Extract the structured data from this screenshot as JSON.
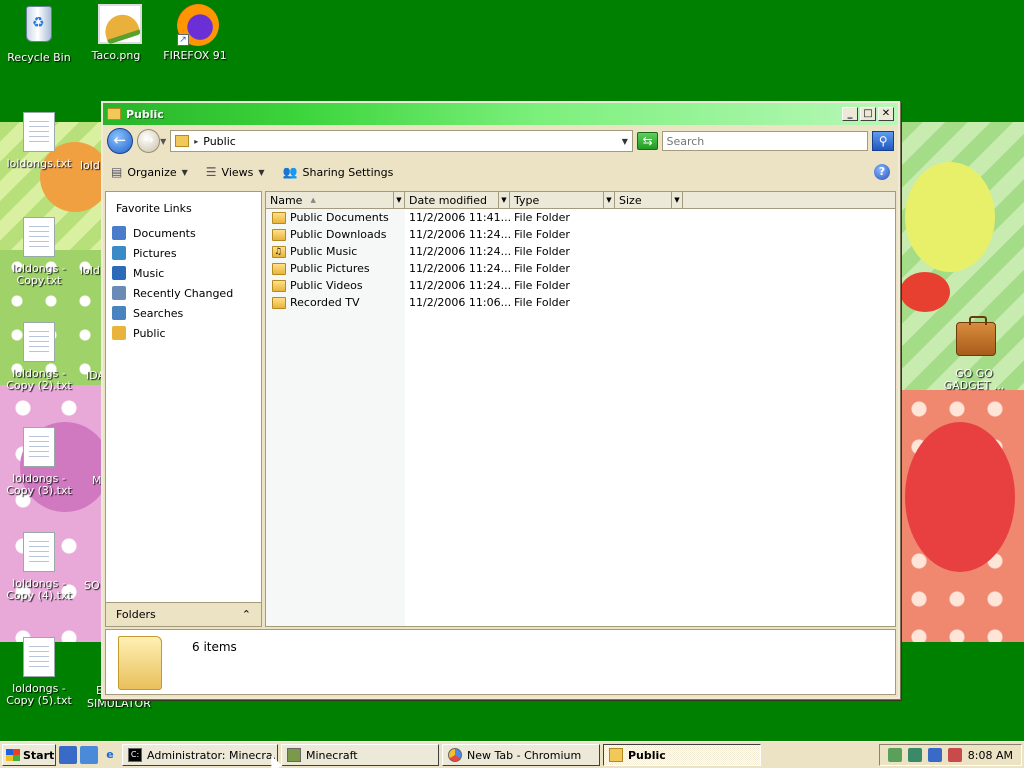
{
  "desktop": {
    "top_icons": [
      {
        "label": "Recycle Bin",
        "icon": "recycle-bin-icon"
      },
      {
        "label": "Taco.png",
        "icon": "image-file-icon"
      },
      {
        "label": "FIREFOX 91",
        "icon": "firefox-icon"
      }
    ],
    "left_icons": [
      {
        "label": "loldongs.txt"
      },
      {
        "label": "loldongs - Copy.txt"
      },
      {
        "label": "loldongs - Copy (2).txt"
      },
      {
        "label": "loldongs - Copy (3).txt"
      },
      {
        "label": "loldongs - Copy (4).txt"
      },
      {
        "label": "loldongs - Copy (5).txt"
      }
    ],
    "partial_labels": {
      "p1": "lold",
      "p2": "lold",
      "p3": "IDA",
      "p4": "M",
      "p5": "SO",
      "p6": "E",
      "p7": "SIMULATOR"
    },
    "right_icon": {
      "label": "GO GO GADGET ...",
      "icon": "briefcase-icon"
    }
  },
  "window": {
    "title": "Public",
    "controls": {
      "minimize": "_",
      "maximize": "□",
      "close": "✕"
    },
    "address": {
      "path": "Public",
      "search_placeholder": "Search"
    },
    "toolbar": {
      "organize": "Organize",
      "views": "Views",
      "sharing": "Sharing Settings",
      "help": "?"
    },
    "nav": {
      "heading": "Favorite Links",
      "items": [
        {
          "label": "Documents",
          "color": "#4a7ccc"
        },
        {
          "label": "Pictures",
          "color": "#3a8ac8"
        },
        {
          "label": "Music",
          "color": "#2a6ab8"
        },
        {
          "label": "Recently Changed",
          "color": "#6a8ab8"
        },
        {
          "label": "Searches",
          "color": "#4a84c0"
        },
        {
          "label": "Public",
          "color": "#e8b43c"
        }
      ],
      "folders_label": "Folders",
      "folders_chevron": "⌃"
    },
    "columns": {
      "name": "Name",
      "date": "Date modified",
      "type": "Type",
      "size": "Size"
    },
    "files": [
      {
        "name": "Public Documents",
        "date": "11/2/2006 11:41...",
        "type": "File Folder",
        "icon": "folder-icon"
      },
      {
        "name": "Public Downloads",
        "date": "11/2/2006 11:24...",
        "type": "File Folder",
        "icon": "folder-icon"
      },
      {
        "name": "Public Music",
        "date": "11/2/2006 11:24...",
        "type": "File Folder",
        "icon": "music-folder-icon"
      },
      {
        "name": "Public Pictures",
        "date": "11/2/2006 11:24...",
        "type": "File Folder",
        "icon": "pictures-folder-icon"
      },
      {
        "name": "Public Videos",
        "date": "11/2/2006 11:24...",
        "type": "File Folder",
        "icon": "videos-folder-icon"
      },
      {
        "name": "Recorded TV",
        "date": "11/2/2006 11:06...",
        "type": "File Folder",
        "icon": "folder-icon"
      }
    ],
    "details": {
      "count": "6 items"
    }
  },
  "taskbar": {
    "start": "Start",
    "tasks": [
      {
        "label": "Administrator:  Minecra...",
        "icon": "console-icon"
      },
      {
        "label": "Minecraft",
        "icon": "minecraft-icon"
      },
      {
        "label": "New Tab - Chromium",
        "icon": "chromium-icon"
      },
      {
        "label": "Public",
        "icon": "folder-icon"
      }
    ],
    "clock": "8:08 AM"
  }
}
